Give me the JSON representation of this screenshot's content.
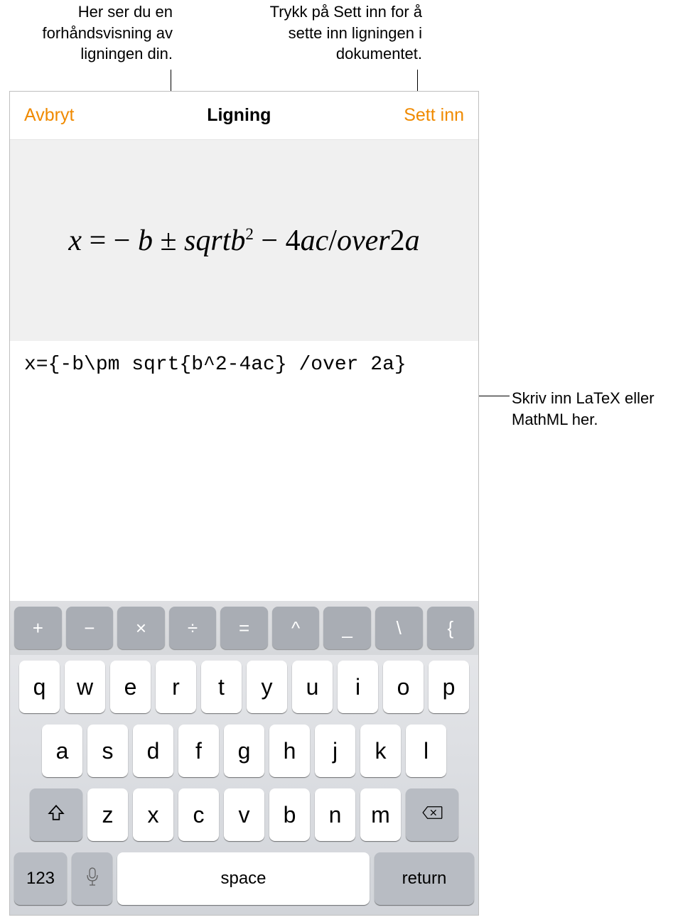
{
  "callouts": {
    "preview": "Her ser du en forhåndsvisning av ligningen din.",
    "insert": "Trykk på Sett inn for å sette inn ligningen i dokumentet.",
    "latex": "Skriv inn LaTeX eller MathML her."
  },
  "navbar": {
    "cancel": "Avbryt",
    "title": "Ligning",
    "insert": "Sett inn"
  },
  "preview": {
    "rendered_plain": "x = − b ± sqrtb² − 4ac/over2a"
  },
  "input": {
    "value": "x={-b\\pm sqrt{b^2-4ac} /over 2a}"
  },
  "keyboard": {
    "symbol_row": [
      "+",
      "−",
      "×",
      "÷",
      "=",
      "^",
      "_",
      "\\",
      "{"
    ],
    "row1": [
      "q",
      "w",
      "e",
      "r",
      "t",
      "y",
      "u",
      "i",
      "o",
      "p"
    ],
    "row2": [
      "a",
      "s",
      "d",
      "f",
      "g",
      "h",
      "j",
      "k",
      "l"
    ],
    "row3": [
      "z",
      "x",
      "c",
      "v",
      "b",
      "n",
      "m"
    ],
    "numbers_label": "123",
    "space_label": "space",
    "return_label": "return"
  }
}
